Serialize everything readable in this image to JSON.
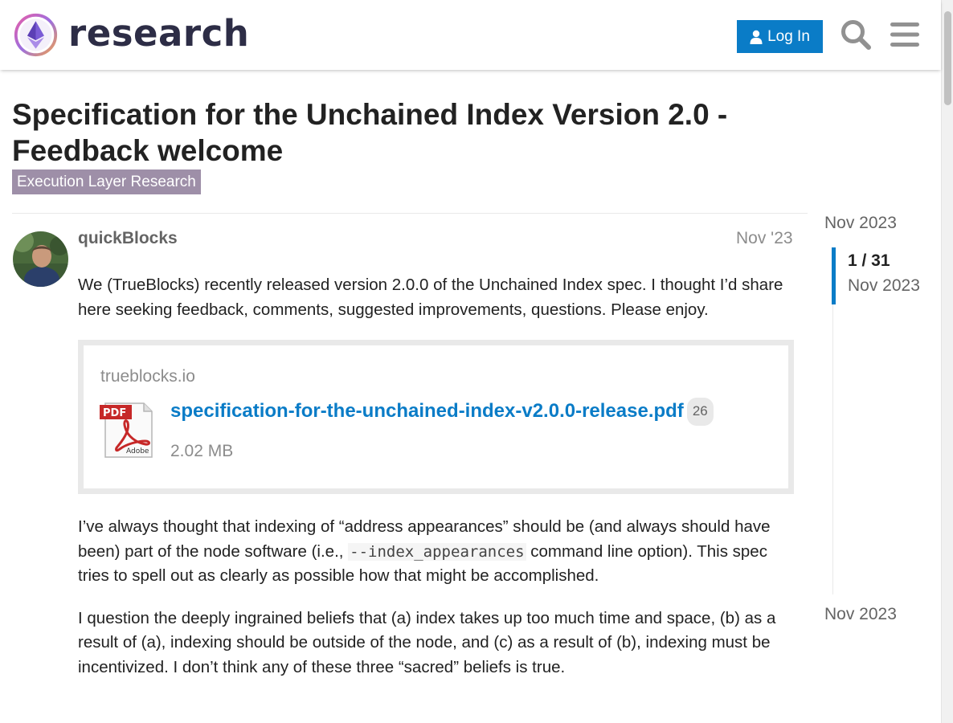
{
  "header": {
    "logo_text": "research",
    "login_label": "Log In"
  },
  "topic": {
    "title": "Specification for the Unchained Index Version 2.0 - Feedback welcome",
    "category": "Execution Layer Research"
  },
  "post": {
    "username": "quickBlocks",
    "date": "Nov '23",
    "intro": "We (TrueBlocks) recently released version 2.0.0 of the Unchained Index spec. I thought I’d share here seeking feedback, comments, suggested improvements, questions. Please enjoy.",
    "onebox": {
      "source": "trueblocks.io",
      "filename": "specification-for-the-unchained-index-v2.0.0-release.pdf",
      "clicks": "26",
      "size": "2.02 MB"
    },
    "para2_before": "I’ve always thought that indexing of “address appearances” should be (and always should have been) part of the node software (i.e., ",
    "para2_code": "--index_appearances",
    "para2_after": " command line option). This spec tries to spell out as clearly as possible how that might be accomplished.",
    "para3": "I question the deeply ingrained beliefs that (a) index takes up too much time and space, (b) as a result of (a), indexing should be outside of the node, and (c) as a result of (b), indexing must be incentivized. I don’t think any of these three “sacred” beliefs is true."
  },
  "timeline": {
    "start": "Nov 2023",
    "position": "1 / 31",
    "current_date": "Nov 2023",
    "end": "Nov 2023"
  },
  "colors": {
    "accent": "#0a7cc7",
    "category": "#9e8fa8"
  }
}
